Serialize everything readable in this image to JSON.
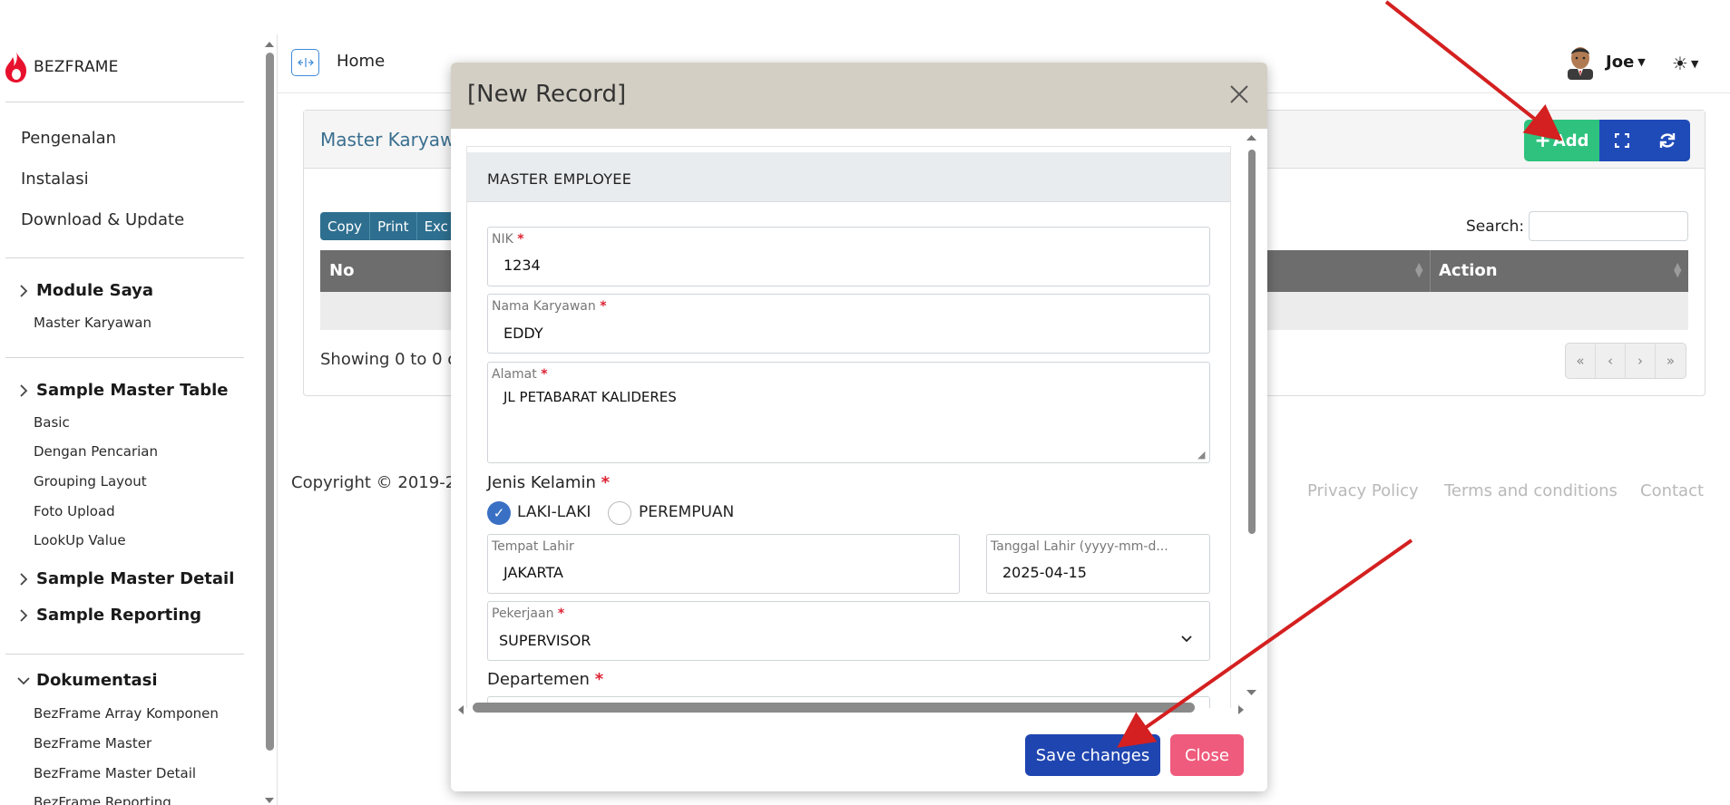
{
  "brand": {
    "name": "BEZFRAME",
    "accent": "#e8112d"
  },
  "sidebar": {
    "links": [
      "Pengenalan",
      "Instalasi",
      "Download & Update"
    ],
    "groups": [
      {
        "label": "Module Saya",
        "expanded": false,
        "items": [
          "Master Karyawan"
        ]
      },
      {
        "label": "Sample Master Table",
        "expanded": false,
        "items": [
          "Basic",
          "Dengan Pencarian",
          "Grouping Layout",
          "Foto Upload",
          "LookUp Value"
        ]
      },
      {
        "label": "Sample Master Detail",
        "expanded": false,
        "items": []
      },
      {
        "label": "Sample Reporting",
        "expanded": false,
        "items": []
      },
      {
        "label": "Dokumentasi",
        "expanded": true,
        "items": [
          "BezFrame Array Komponen",
          "BezFrame Master",
          "BezFrame Master Detail",
          "BezFrame Reporting"
        ]
      }
    ]
  },
  "topbar": {
    "home": "Home",
    "user": "Joe"
  },
  "card": {
    "title": "Master Karyaw",
    "add_label": "Add",
    "dt_buttons": [
      "Copy",
      "Print",
      "Exc"
    ],
    "search_label": "Search:",
    "columns": {
      "no": "No",
      "action": "Action"
    },
    "showing": "Showing 0 to 0 of",
    "pager": [
      "«",
      "‹",
      "›",
      "»"
    ]
  },
  "footer": {
    "copyright": "Copyright © 2019-20",
    "links": [
      "Privacy Policy",
      "Terms and conditions",
      "Contact"
    ]
  },
  "modal": {
    "title": "[New Record]",
    "section": "MASTER EMPLOYEE",
    "fields": {
      "nik": {
        "label": "NIK",
        "value": "1234"
      },
      "nama": {
        "label": "Nama Karyawan",
        "value": "EDDY"
      },
      "alamat": {
        "label": "Alamat",
        "value": "JL PETABARAT KALIDERES"
      },
      "jenis_kelamin": {
        "label": "Jenis Kelamin",
        "options": [
          "LAKI-LAKI",
          "PEREMPUAN"
        ],
        "selected": "LAKI-LAKI"
      },
      "tempat_lahir": {
        "label": "Tempat Lahir",
        "value": "JAKARTA"
      },
      "tanggal_lahir": {
        "label": "Tanggal Lahir (yyyy-mm-d...",
        "value": "2025-04-15"
      },
      "pekerjaan": {
        "label": "Pekerjaan",
        "value": "SUPERVISOR"
      },
      "departemen": {
        "label": "Departemen"
      }
    },
    "save_label": "Save changes",
    "close_label": "Close"
  },
  "colors": {
    "add": "#2ec27e",
    "primary": "#1f45b0",
    "danger": "#ef5b7c",
    "table_head": "#6d6d6d",
    "modal_head": "#d4cfc4",
    "annotation": "#d42020"
  }
}
